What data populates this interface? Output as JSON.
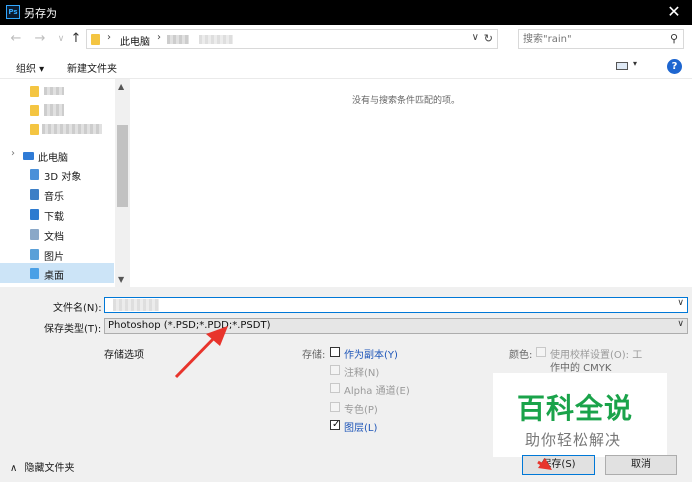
{
  "window": {
    "icon": "Ps",
    "title": "另存为",
    "close_glyph": "✕"
  },
  "address": {
    "back_glyph": "←",
    "forward_glyph": "→",
    "history_glyph": "∨",
    "up_glyph": "↑",
    "sep_glyph": "›",
    "dropdown_glyph": "∨",
    "refresh_glyph": "↻",
    "breadcrumb": "此电脑"
  },
  "search": {
    "placeholder": "搜索\"rain\"",
    "icon": "search-icon",
    "icon_glyph": "⚲"
  },
  "toolbar": {
    "organize_label": "组织 ▾",
    "new_folder_label": "新建文件夹",
    "view_caret": "▾",
    "help_label": "?"
  },
  "nav": {
    "up_glyph": "▲",
    "down_glyph": "▼",
    "expand_glyph": "›",
    "items": [
      {
        "label": "此电脑",
        "color": "#2f7bd6"
      },
      {
        "label": "3D 对象",
        "color": "#4a90d9"
      },
      {
        "label": "音乐",
        "color": "#3d7fc6"
      },
      {
        "label": "下载",
        "color": "#2d7bd0"
      },
      {
        "label": "文档",
        "color": "#8aa8c8"
      },
      {
        "label": "图片",
        "color": "#5aa0d8"
      },
      {
        "label": "桌面",
        "color": "#4aa0e6"
      }
    ]
  },
  "files": {
    "empty_message": "没有与搜索条件匹配的项。"
  },
  "form": {
    "filename_label": "文件名(N):",
    "filename_value": "",
    "filetype_label": "保存类型(T):",
    "filetype_value": "Photoshop (*.PSD;*.PDD;*.PSDT)",
    "dropdown_glyph": "∨"
  },
  "options": {
    "section_label": "存储选项",
    "storage_label": "存储:",
    "check_glyph": "✓",
    "as_copy": "作为副本(Y)",
    "notes": "注释(N)",
    "alpha": "Alpha 通道(E)",
    "spot": "专色(P)",
    "layers": "图层(L)",
    "layers_checked": true,
    "color_label": "颜色:",
    "proof_setup_line1": "使用校样设置(O): 工",
    "proof_setup_line2": "作中的 CMYK"
  },
  "watermark": {
    "big": "百科全说",
    "small": "助你轻松解决"
  },
  "footer": {
    "hide_folders": "隐藏文件夹",
    "hide_glyph": "∧",
    "save_label": "保存(S)",
    "cancel_label": "取消"
  },
  "colors": {
    "accent": "#0078d7",
    "annotation_arrow": "#e8342c",
    "watermark_green": "#1aa34a"
  }
}
